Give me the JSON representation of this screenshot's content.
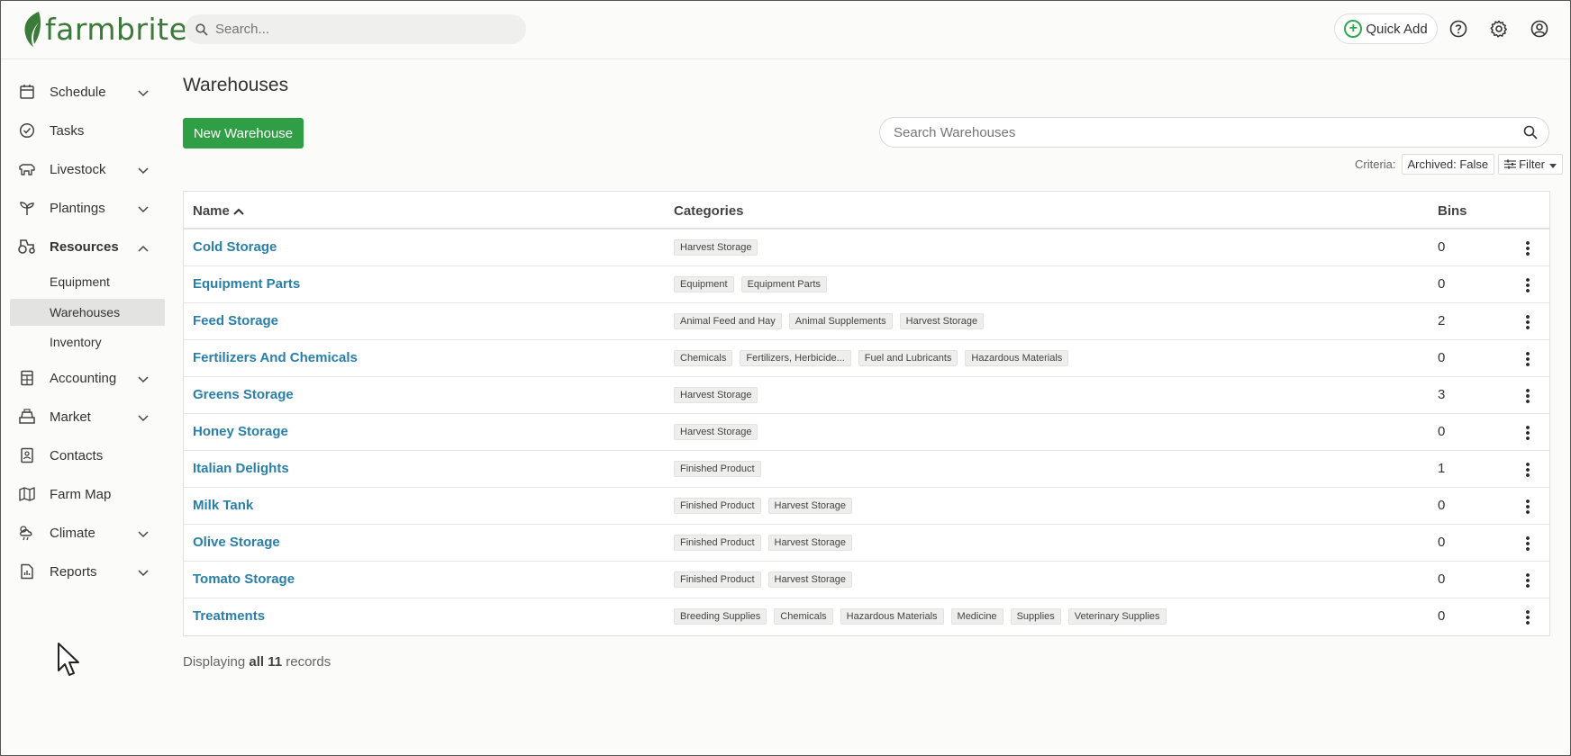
{
  "app": {
    "logo_text": "farmbrite",
    "brand_color": "#3c7a3a",
    "accent_color": "#2f9e44",
    "link_color": "#2a7fa8"
  },
  "header": {
    "search_placeholder": "Search...",
    "quick_add_label": "Quick Add",
    "icons": [
      "help-icon",
      "settings-icon",
      "account-icon"
    ]
  },
  "sidebar": {
    "items": [
      {
        "label": "Schedule",
        "icon": "calendar-icon",
        "expandable": true
      },
      {
        "label": "Tasks",
        "icon": "check-circle-icon",
        "expandable": false
      },
      {
        "label": "Livestock",
        "icon": "cow-icon",
        "expandable": true
      },
      {
        "label": "Plantings",
        "icon": "sprout-icon",
        "expandable": true
      },
      {
        "label": "Resources",
        "icon": "tractor-icon",
        "expandable": true,
        "expanded": true
      },
      {
        "label": "Accounting",
        "icon": "calculator-icon",
        "expandable": true
      },
      {
        "label": "Market",
        "icon": "register-icon",
        "expandable": true
      },
      {
        "label": "Contacts",
        "icon": "contact-card-icon",
        "expandable": false
      },
      {
        "label": "Farm Map",
        "icon": "map-icon",
        "expandable": false
      },
      {
        "label": "Climate",
        "icon": "cloud-rain-icon",
        "expandable": true
      },
      {
        "label": "Reports",
        "icon": "report-icon",
        "expandable": true
      }
    ],
    "resources_sub": [
      {
        "label": "Equipment"
      },
      {
        "label": "Warehouses",
        "active": true
      },
      {
        "label": "Inventory"
      }
    ]
  },
  "main": {
    "title": "Warehouses",
    "new_button": "New Warehouse",
    "search_placeholder": "Search Warehouses",
    "criteria_label": "Criteria:",
    "criteria_value": "Archived: False",
    "filter_label": "Filter",
    "columns": {
      "name": "Name",
      "categories": "Categories",
      "bins": "Bins"
    },
    "rows": [
      {
        "name": "Cold Storage",
        "categories": [
          "Harvest Storage"
        ],
        "bins": "0"
      },
      {
        "name": "Equipment Parts",
        "categories": [
          "Equipment",
          "Equipment Parts"
        ],
        "bins": "0"
      },
      {
        "name": "Feed Storage",
        "categories": [
          "Animal Feed and Hay",
          "Animal Supplements",
          "Harvest Storage"
        ],
        "bins": "2"
      },
      {
        "name": "Fertilizers And Chemicals",
        "categories": [
          "Chemicals",
          "Fertilizers, Herbicide...",
          "Fuel and Lubricants",
          "Hazardous Materials"
        ],
        "bins": "0"
      },
      {
        "name": "Greens Storage",
        "categories": [
          "Harvest Storage"
        ],
        "bins": "3"
      },
      {
        "name": "Honey Storage",
        "categories": [
          "Harvest Storage"
        ],
        "bins": "0"
      },
      {
        "name": "Italian Delights",
        "categories": [
          "Finished Product"
        ],
        "bins": "1"
      },
      {
        "name": "Milk Tank",
        "categories": [
          "Finished Product",
          "Harvest Storage"
        ],
        "bins": "0"
      },
      {
        "name": "Olive Storage",
        "categories": [
          "Finished Product",
          "Harvest Storage"
        ],
        "bins": "0"
      },
      {
        "name": "Tomato Storage",
        "categories": [
          "Finished Product",
          "Harvest Storage"
        ],
        "bins": "0"
      },
      {
        "name": "Treatments",
        "categories": [
          "Breeding Supplies",
          "Chemicals",
          "Hazardous Materials",
          "Medicine",
          "Supplies",
          "Veterinary Supplies"
        ],
        "bins": "0"
      }
    ],
    "footer": {
      "prefix": "Displaying",
      "bold": "all 11",
      "suffix": "records"
    }
  }
}
